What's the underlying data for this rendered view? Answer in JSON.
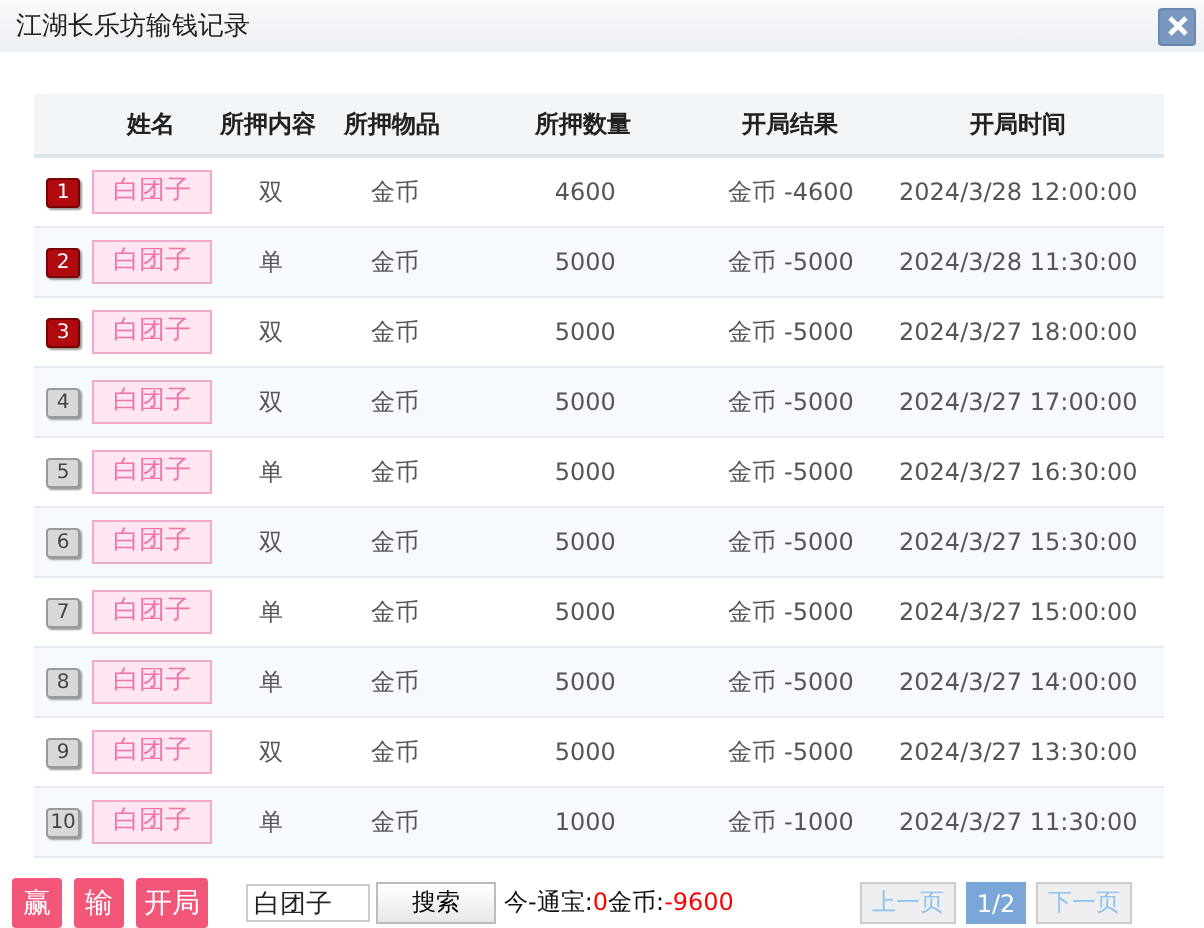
{
  "window": {
    "title": "江湖长乐坊输钱记录"
  },
  "table": {
    "columns": [
      "姓名",
      "所押内容",
      "所押物品",
      "所押数量",
      "开局结果",
      "开局时间"
    ],
    "rows": [
      {
        "rank": "1",
        "kind": "top",
        "name": "白团子",
        "bet": "双",
        "item": "金币",
        "amount": "4600",
        "result": "金币 -4600",
        "time": "2024/3/28 12:00:00"
      },
      {
        "rank": "2",
        "kind": "top",
        "name": "白团子",
        "bet": "单",
        "item": "金币",
        "amount": "5000",
        "result": "金币 -5000",
        "time": "2024/3/28 11:30:00"
      },
      {
        "rank": "3",
        "kind": "top",
        "name": "白团子",
        "bet": "双",
        "item": "金币",
        "amount": "5000",
        "result": "金币 -5000",
        "time": "2024/3/27 18:00:00"
      },
      {
        "rank": "4",
        "kind": "normal",
        "name": "白团子",
        "bet": "双",
        "item": "金币",
        "amount": "5000",
        "result": "金币 -5000",
        "time": "2024/3/27 17:00:00"
      },
      {
        "rank": "5",
        "kind": "normal",
        "name": "白团子",
        "bet": "单",
        "item": "金币",
        "amount": "5000",
        "result": "金币 -5000",
        "time": "2024/3/27 16:30:00"
      },
      {
        "rank": "6",
        "kind": "normal",
        "name": "白团子",
        "bet": "双",
        "item": "金币",
        "amount": "5000",
        "result": "金币 -5000",
        "time": "2024/3/27 15:30:00"
      },
      {
        "rank": "7",
        "kind": "normal",
        "name": "白团子",
        "bet": "单",
        "item": "金币",
        "amount": "5000",
        "result": "金币 -5000",
        "time": "2024/3/27 15:00:00"
      },
      {
        "rank": "8",
        "kind": "normal",
        "name": "白团子",
        "bet": "单",
        "item": "金币",
        "amount": "5000",
        "result": "金币 -5000",
        "time": "2024/3/27 14:00:00"
      },
      {
        "rank": "9",
        "kind": "normal",
        "name": "白团子",
        "bet": "双",
        "item": "金币",
        "amount": "5000",
        "result": "金币 -5000",
        "time": "2024/3/27 13:30:00"
      },
      {
        "rank": "10",
        "kind": "normal",
        "name": "白团子",
        "bet": "单",
        "item": "金币",
        "amount": "1000",
        "result": "金币 -1000",
        "time": "2024/3/27 11:30:00"
      }
    ]
  },
  "actions": [
    "赢",
    "输",
    "开局"
  ],
  "search": {
    "value": "白团子",
    "button": "搜索"
  },
  "summary": [
    {
      "text": "今-通宝:",
      "kind": "label"
    },
    {
      "text": "0",
      "kind": "value"
    },
    {
      "text": "金币:",
      "kind": "label"
    },
    {
      "text": "-9600",
      "kind": "value"
    }
  ],
  "pager": [
    {
      "label": "上一页",
      "kind": "nav"
    },
    {
      "label": "1/2",
      "kind": "page"
    },
    {
      "label": "下一页",
      "kind": "nav"
    }
  ]
}
